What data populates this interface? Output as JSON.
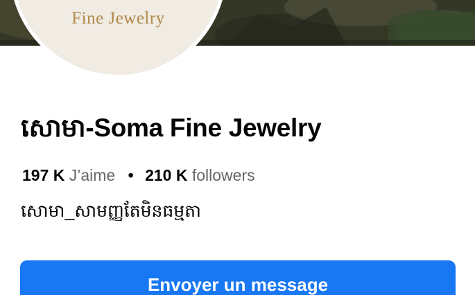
{
  "profile": {
    "logo_text": "Fine Jewelry",
    "name": "សោមា-Soma Fine Jewelry",
    "likes_count": "197 K",
    "likes_label": "J’aime",
    "separator": "•",
    "followers_count": "210 K",
    "followers_label": "followers",
    "bio": "សោមា_សាមញ្ញតែមិនធម្មតា"
  },
  "actions": {
    "message_label": "Envoyer un message"
  },
  "colors": {
    "accent": "#1877f2",
    "logo_gold": "#b08a4a",
    "avatar_bg": "#f0ebe3",
    "secondary_text": "#65676b"
  }
}
